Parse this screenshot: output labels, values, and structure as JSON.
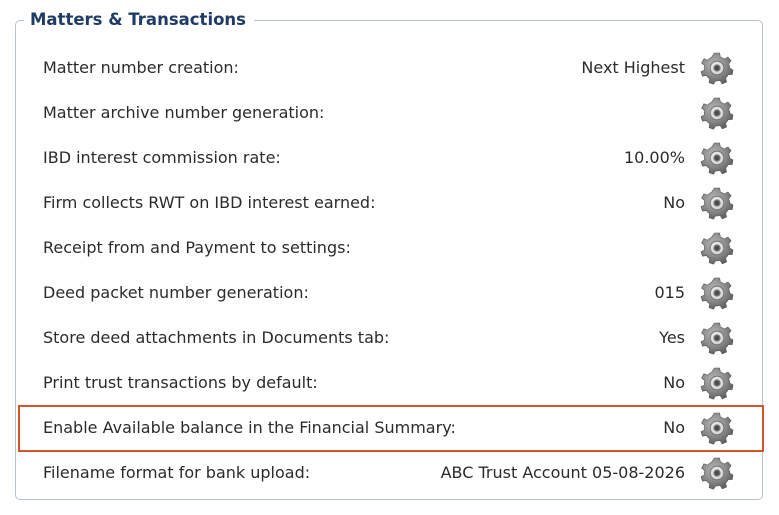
{
  "panel": {
    "title": "Matters & Transactions"
  },
  "settings": [
    {
      "label": "Matter number creation:",
      "value": "Next Highest",
      "icon": "gear-icon"
    },
    {
      "label": "Matter archive number generation:",
      "value": "",
      "icon": "gear-icon"
    },
    {
      "label": "IBD interest commission rate:",
      "value": "10.00%",
      "icon": "gear-icon"
    },
    {
      "label": "Firm collects RWT on IBD interest earned:",
      "value": "No",
      "icon": "gear-icon"
    },
    {
      "label": "Receipt from and Payment to settings:",
      "value": "",
      "icon": "gear-icon"
    },
    {
      "label": "Deed packet number generation:",
      "value": "015",
      "icon": "gear-icon"
    },
    {
      "label": "Store deed attachments in Documents tab:",
      "value": "Yes",
      "icon": "gear-icon"
    },
    {
      "label": "Print trust transactions by default:",
      "value": "No",
      "icon": "gear-icon"
    },
    {
      "label": "Enable Available balance in the Financial Summary:",
      "value": "No",
      "icon": "gear-icon",
      "highlighted": true
    },
    {
      "label": "Filename format for bank upload:",
      "value": "ABC Trust Account 05-08-2026",
      "icon": "gear-icon"
    }
  ],
  "colors": {
    "title": "#1f3b66",
    "border": "#b9c3cf",
    "highlight": "#d2562a"
  }
}
